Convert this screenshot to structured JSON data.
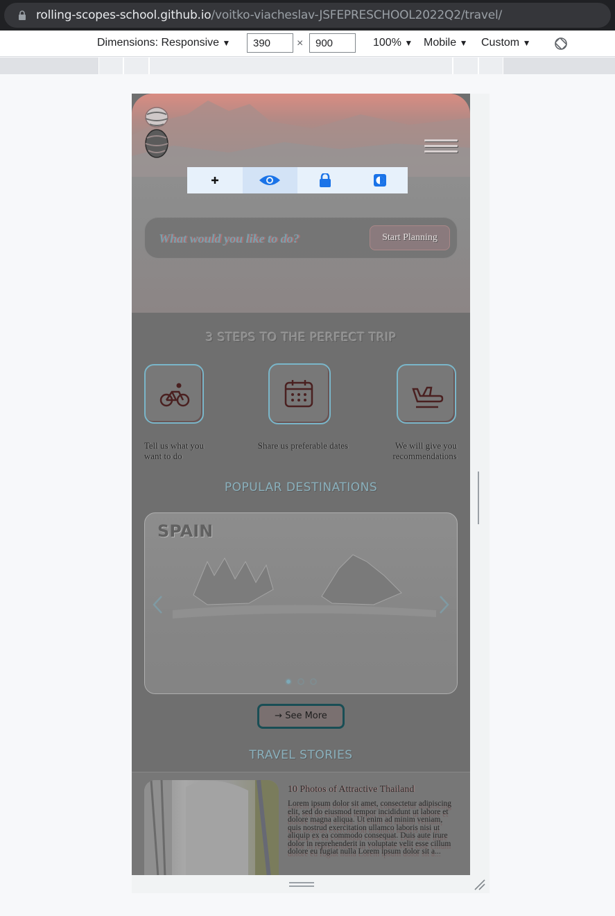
{
  "browser": {
    "url_host": "rolling-scopes-school.github.io",
    "url_path": "/voitko-viacheslav-JSFEPRESCHOOL2022Q2/travel/"
  },
  "devtools": {
    "dimensions_label": "Dimensions: Responsive",
    "width": "390",
    "times": "×",
    "height": "900",
    "zoom": "100%",
    "device_type": "Mobile",
    "throttle": "Custom"
  },
  "hero": {
    "search_placeholder": "What would you like to do?",
    "plan_button": "Start Planning"
  },
  "steps": {
    "title": "3 STEPS TO THE PERFECT TRIP",
    "items": [
      {
        "text": "Tell us what you want to do",
        "icon": "bicycle-icon"
      },
      {
        "text": "Share us preferable dates",
        "icon": "calendar-icon"
      },
      {
        "text": "We will give you recommendations",
        "icon": "airplane-icon"
      }
    ]
  },
  "destinations": {
    "title": "POPULAR DESTINATIONS",
    "current": "SPAIN",
    "dots": 3,
    "active_dot": 0,
    "see_more": "→ See More"
  },
  "stories": {
    "title": "TRAVEL STORIES",
    "item_title": "10 Photos of Attractive Thailand",
    "item_text": "Lorem ipsum dolor sit amet, consectetur adipiscing elit, sed do eiusmod tempor incididunt ut labore et dolore magna aliqua. Ut enim ad minim veniam, quis nostrud exercitation ullamco laboris nisi ut aliquip ex ea commodo consequat. Duis aute irure dolor in reprehenderit in voluptate velit esse cillum dolore eu fugiat nulla Lorem ipsum dolor sit a..."
  },
  "colors": {
    "chrome_dark": "#202124",
    "accent_blue": "#1a73e8",
    "card_border": "#7ab6c9",
    "see_more_border": "#194e55"
  }
}
